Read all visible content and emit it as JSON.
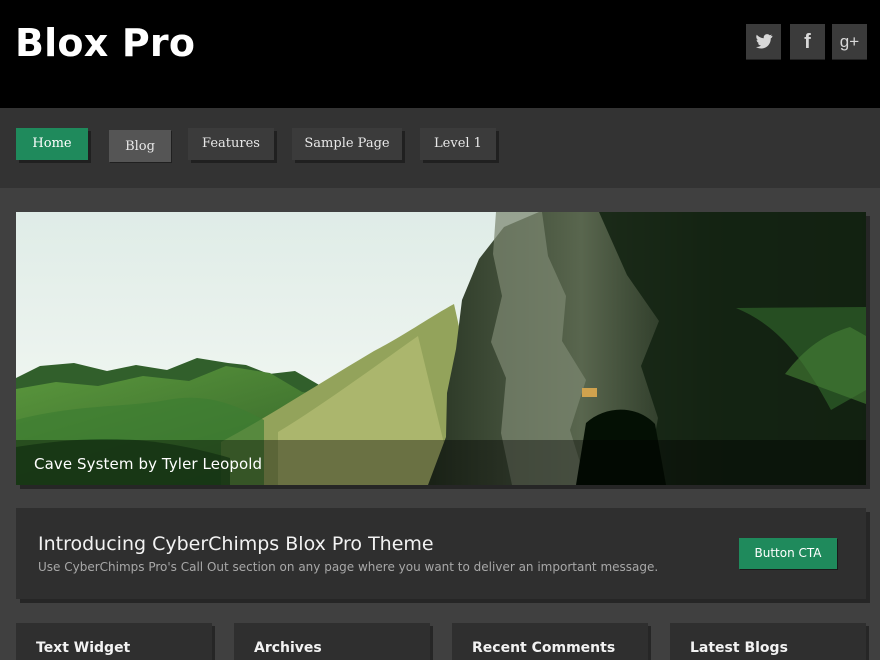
{
  "header": {
    "site_title": "Blox Pro",
    "social_links": [
      {
        "icon": "twitter-icon",
        "glyph": "🐦"
      },
      {
        "icon": "facebook-icon",
        "glyph": "f"
      },
      {
        "icon": "google-plus-icon",
        "glyph": "g+"
      }
    ]
  },
  "nav": {
    "items": [
      {
        "label": "Home",
        "active": true
      },
      {
        "label": "Blog",
        "active": false
      },
      {
        "label": "Features",
        "active": false
      },
      {
        "label": "Sample Page",
        "active": false
      },
      {
        "label": "Level 1",
        "active": false
      }
    ]
  },
  "hero": {
    "caption": "Cave System by Tyler Leopold"
  },
  "callout": {
    "title": "Introducing CyberChimps Blox Pro Theme",
    "text": "Use CyberChimps Pro's Call Out section on any page where you want to deliver an important message.",
    "button_label": "Button CTA"
  },
  "widgets": {
    "titles": [
      "Text Widget",
      "Archives",
      "Recent Comments",
      "Latest Blogs"
    ]
  },
  "colors": {
    "header_background": "#000000",
    "nav_background": "#333333",
    "accent_green": "#1f8a5c",
    "page_background": "#404040",
    "panel_background": "#2f2f2f"
  }
}
